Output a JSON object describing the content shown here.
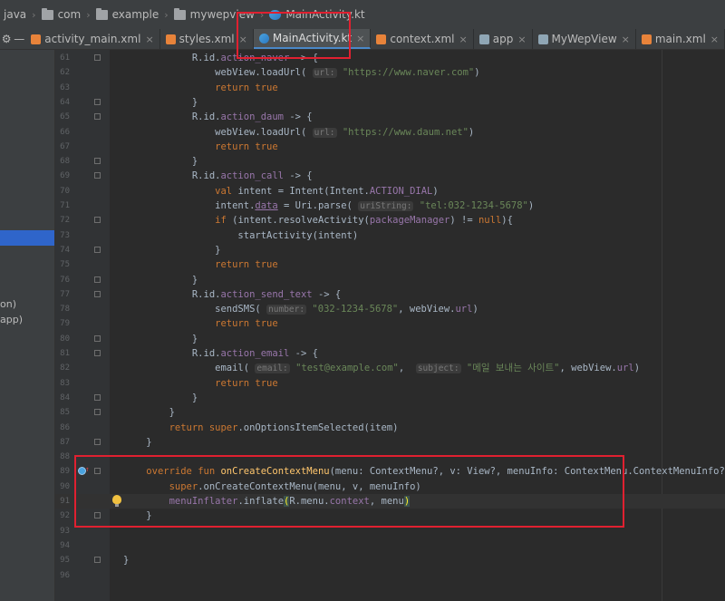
{
  "breadcrumb": [
    {
      "label": "java",
      "icon": "none"
    },
    {
      "label": "com",
      "icon": "folder-icon"
    },
    {
      "label": "example",
      "icon": "folder-icon"
    },
    {
      "label": "mywepview",
      "icon": "folder-icon"
    },
    {
      "label": "MainActivity.kt",
      "icon": "kotlin-file-icon"
    }
  ],
  "tabs": [
    {
      "label": "activity_main.xml",
      "icon": "xml-icon",
      "active": false
    },
    {
      "label": "styles.xml",
      "icon": "xml-icon",
      "active": false
    },
    {
      "label": "MainActivity.kt",
      "icon": "kotlin-file-icon",
      "active": true
    },
    {
      "label": "context.xml",
      "icon": "xml-icon",
      "active": false
    },
    {
      "label": "app",
      "icon": "android-icon",
      "active": false
    },
    {
      "label": "MyWepView",
      "icon": "android-icon",
      "active": false
    },
    {
      "label": "main.xml",
      "icon": "xml-icon",
      "active": false
    }
  ],
  "sidebar": {
    "fragments": [
      "on)",
      "app)"
    ]
  },
  "code_lines": [
    {
      "n": "61",
      "html": "            R.id.<span class=\"prop\">action_naver</span> -> {",
      "fold": true
    },
    {
      "n": "62",
      "html": "                webView.loadUrl( <span class=\"param\">url:</span> <span class=\"str\">\"https://www.naver.com\"</span>)"
    },
    {
      "n": "63",
      "html": "                <span class=\"kw\">return true</span>"
    },
    {
      "n": "64",
      "html": "            }",
      "fold": true
    },
    {
      "n": "65",
      "html": "            R.id.<span class=\"prop\">action_daum</span> -> {",
      "fold": true
    },
    {
      "n": "66",
      "html": "                webView.loadUrl( <span class=\"param\">url:</span> <span class=\"str\">\"https://www.daum.net\"</span>)"
    },
    {
      "n": "67",
      "html": "                <span class=\"kw\">return true</span>"
    },
    {
      "n": "68",
      "html": "            }",
      "fold": true
    },
    {
      "n": "69",
      "html": "            R.id.<span class=\"prop\">action_call</span> -> {",
      "fold": true
    },
    {
      "n": "70",
      "html": "                <span class=\"kw\">val</span> intent = Intent(Intent.<span class=\"prop\">ACTION_DIAL</span>)"
    },
    {
      "n": "71",
      "html": "                intent.<span class=\"prop under\">data</span> = Uri.parse( <span class=\"param\">uriString:</span> <span class=\"str\">\"tel:032-1234-5678\"</span>)"
    },
    {
      "n": "72",
      "html": "                <span class=\"kw\">if</span> (intent.resolveActivity(<span class=\"prop\">packageManager</span>) != <span class=\"kw\">null</span>){",
      "fold": true
    },
    {
      "n": "73",
      "html": "                    startActivity(intent)"
    },
    {
      "n": "74",
      "html": "                }",
      "fold": true
    },
    {
      "n": "75",
      "html": "                <span class=\"kw\">return true</span>"
    },
    {
      "n": "76",
      "html": "            }",
      "fold": true
    },
    {
      "n": "77",
      "html": "            R.id.<span class=\"prop\">action_send_text</span> -> {",
      "fold": true
    },
    {
      "n": "78",
      "html": "                sendSMS( <span class=\"param\">number:</span> <span class=\"str\">\"032-1234-5678\"</span>, webView.<span class=\"prop\">url</span>)"
    },
    {
      "n": "79",
      "html": "                <span class=\"kw\">return true</span>"
    },
    {
      "n": "80",
      "html": "            }",
      "fold": true
    },
    {
      "n": "81",
      "html": "            R.id.<span class=\"prop\">action_email</span> -> {",
      "fold": true
    },
    {
      "n": "82",
      "html": "                email( <span class=\"param\">email:</span> <span class=\"str\">\"test@example.com\"</span>,  <span class=\"param\">subject:</span> <span class=\"str\">\"메일 보내는 사이트\"</span>, webView.<span class=\"prop\">url</span>)"
    },
    {
      "n": "83",
      "html": "                <span class=\"kw\">return true</span>"
    },
    {
      "n": "84",
      "html": "            }",
      "fold": true
    },
    {
      "n": "85",
      "html": "        }",
      "fold": true
    },
    {
      "n": "86",
      "html": "        <span class=\"kw\">return super</span>.onOptionsItemSelected(item)"
    },
    {
      "n": "87",
      "html": "    }",
      "fold": true
    },
    {
      "n": "88",
      "html": ""
    },
    {
      "n": "89",
      "html": "    <span class=\"kw\">override fun</span> <span class=\"fn\">onCreateContextMenu</span>(menu: ContextMenu?, v: View?, menuInfo: ContextMenu.ContextMenuInfo?) {",
      "fold": true,
      "gicon": true
    },
    {
      "n": "90",
      "html": "        <span class=\"kw\">super</span>.onCreateContextMenu(menu, v, menuInfo)"
    },
    {
      "n": "91",
      "html": "        <span class=\"prop\">menuInflater</span>.inflate<span class=\"brace\">(</span>R.menu.<span class=\"prop\">context</span>, menu<span class=\"brace\">)</span>",
      "hl": true,
      "bulb": true
    },
    {
      "n": "92",
      "html": "    }",
      "fold": true
    },
    {
      "n": "93",
      "html": ""
    },
    {
      "n": "94",
      "html": ""
    },
    {
      "n": "95",
      "html": "}",
      "fold": true
    },
    {
      "n": "96",
      "html": ""
    }
  ]
}
